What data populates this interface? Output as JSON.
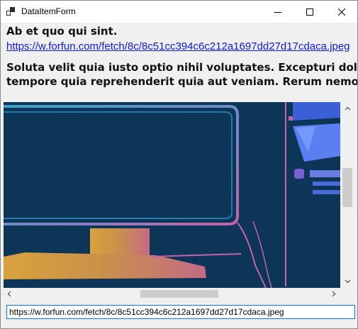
{
  "window": {
    "title": "DataItemForm"
  },
  "content": {
    "heading": "Ab et quo qui sint.",
    "link": "https://w.forfun.com/fetch/8c/8c51cc394c6c212a1697dd27d17cdaca.jpeg",
    "description_line1": "Soluta velit quia iusto optio nihil voluptates. Excepturi dolor",
    "description_line2": "tempore quia reprehenderit quia aut veniam. Rerum nemo non"
  },
  "url_field": {
    "value": "https://w.forfun.com/fetch/8c/8c51cc394c6c212a1697dd27d17cdaca.jpeg"
  },
  "picture": {
    "description_icon": "monitor-illustration",
    "colors": {
      "background": "#0c3558",
      "accent": "#c463a8"
    }
  }
}
